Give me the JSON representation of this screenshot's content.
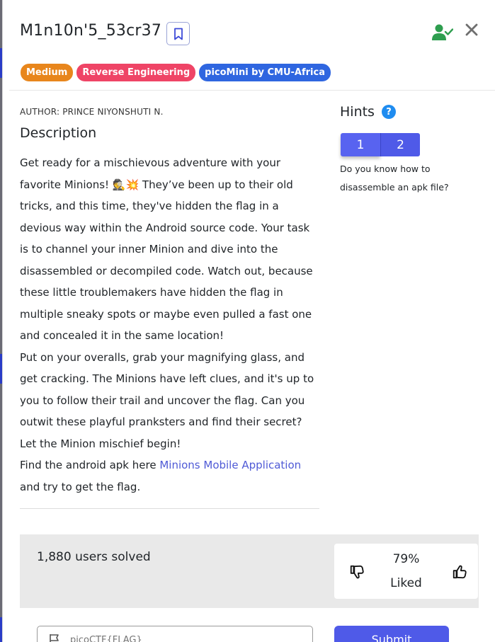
{
  "challenge": {
    "title": "M1n10n'5_53cr37",
    "tags": [
      {
        "label": "Medium",
        "color": "#e8861c"
      },
      {
        "label": "Reverse Engineering",
        "color": "#ef4466"
      },
      {
        "label": "picoMini by CMU-Africa",
        "color": "#2f66e0"
      }
    ],
    "author": "AUTHOR: PRINCE NIYONSHUTI N.",
    "description_heading": "Description",
    "description_p1": "Get ready for a mischievous adventure with your favorite Minions! 🕵️💥 They’ve been up to their old tricks, and this time, they've hidden the flag in a devious way within the Android source code. Your task is to channel your inner Minion and dive into the disassembled or decompiled code. Watch out, because these little troublemakers have hidden the flag in multiple sneaky spots or maybe even pulled a fast one and concealed it in the same location!",
    "description_p2": "Put on your overalls, grab your magnifying glass, and get cracking. The Minions have left clues, and it's up to you to follow their trail and uncover the flag. Can you outwit these playful pranksters and find their secret? Let the Minion mischief begin!",
    "description_p3_before": "Find the android apk here ",
    "description_link": "Minions Mobile Application",
    "description_p3_after": " and try to get the flag."
  },
  "hints": {
    "title": "Hints",
    "help_glyph": "?",
    "tabs": [
      "1",
      "2"
    ],
    "active_text": "Do you know how to disassemble an apk file?"
  },
  "stats": {
    "solved": "1,880 users solved",
    "liked_percent": "79%",
    "liked_label": "Liked"
  },
  "submission": {
    "placeholder": "picoCTF{FLAG}",
    "submit_label": "Submit"
  },
  "colors": {
    "accent": "#4f5ae8",
    "solved_icon": "#2e9e4f"
  },
  "icons": [
    "bookmark-icon",
    "user-check-icon",
    "close-icon",
    "help-icon",
    "thumbs-down-icon",
    "thumbs-up-icon",
    "flag-icon"
  ]
}
